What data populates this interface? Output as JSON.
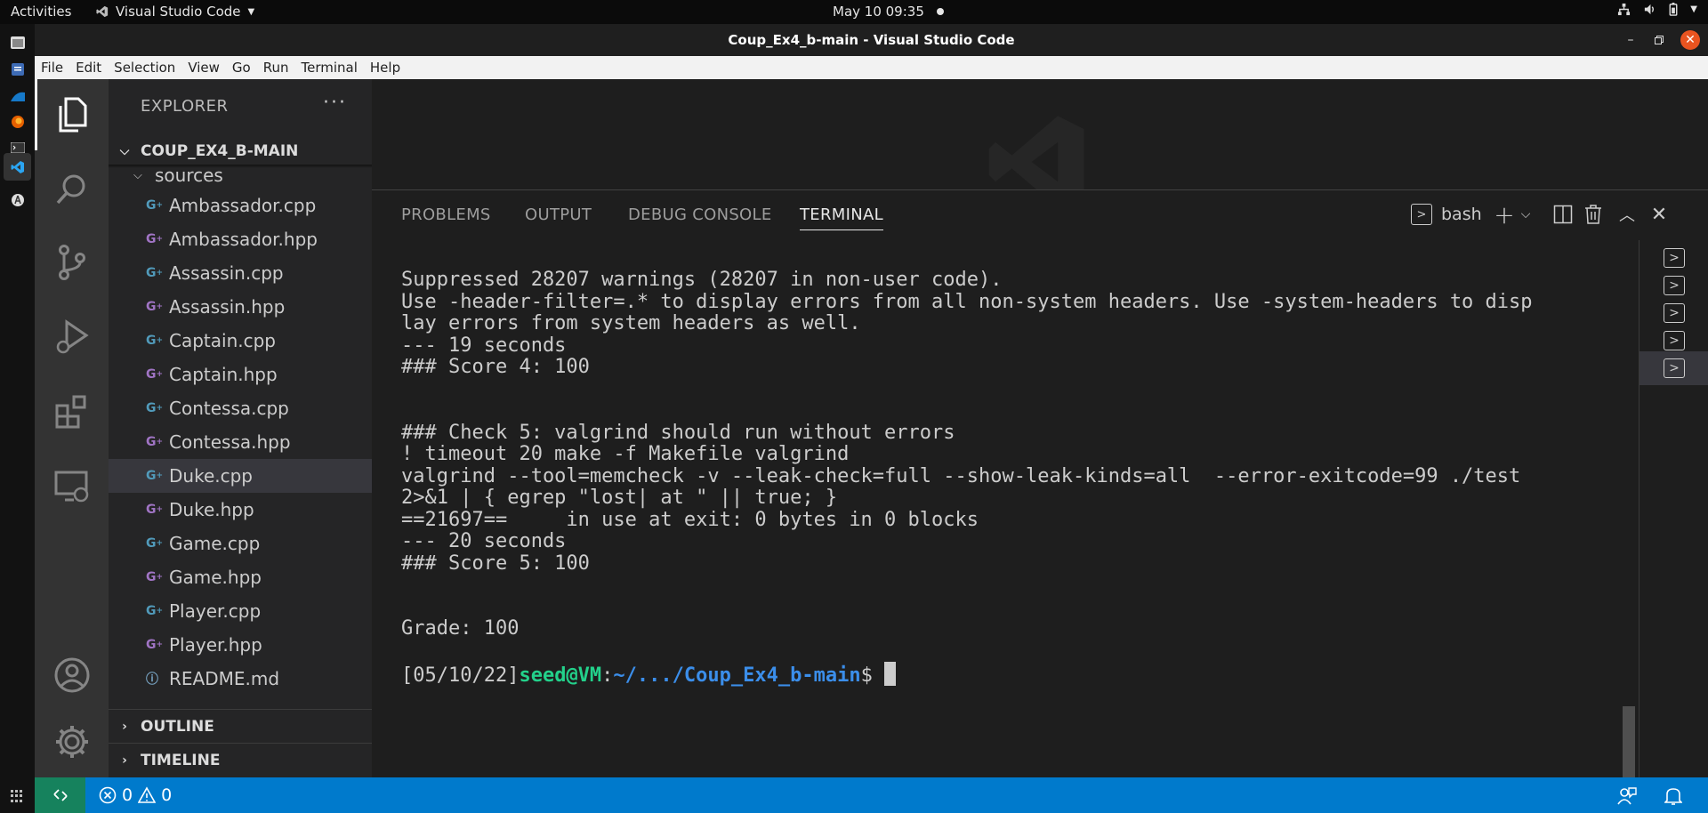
{
  "topbar": {
    "activities": "Activities",
    "app_name": "Visual Studio Code",
    "clock": "May 10  09:35"
  },
  "window": {
    "title": "Coup_Ex4_b-main - Visual Studio Code"
  },
  "menu": [
    "File",
    "Edit",
    "Selection",
    "View",
    "Go",
    "Run",
    "Terminal",
    "Help"
  ],
  "explorer": {
    "header": "EXPLORER",
    "more": "···",
    "root_folder": "COUP_EX4_B-MAIN",
    "subfolder": "sources",
    "files": [
      {
        "name": "Ambassador.cpp",
        "type": "cpp"
      },
      {
        "name": "Ambassador.hpp",
        "type": "hpp"
      },
      {
        "name": "Assassin.cpp",
        "type": "cpp"
      },
      {
        "name": "Assassin.hpp",
        "type": "hpp"
      },
      {
        "name": "Captain.cpp",
        "type": "cpp"
      },
      {
        "name": "Captain.hpp",
        "type": "hpp"
      },
      {
        "name": "Contessa.cpp",
        "type": "cpp"
      },
      {
        "name": "Contessa.hpp",
        "type": "hpp"
      },
      {
        "name": "Duke.cpp",
        "type": "cpp"
      },
      {
        "name": "Duke.hpp",
        "type": "hpp"
      },
      {
        "name": "Game.cpp",
        "type": "cpp"
      },
      {
        "name": "Game.hpp",
        "type": "hpp"
      },
      {
        "name": "Player.cpp",
        "type": "cpp"
      },
      {
        "name": "Player.hpp",
        "type": "hpp"
      },
      {
        "name": "README.md",
        "type": "info"
      }
    ],
    "selected_file": "Duke.cpp",
    "sections": {
      "outline": "OUTLINE",
      "timeline": "TIMELINE"
    }
  },
  "panel": {
    "tabs": [
      "PROBLEMS",
      "OUTPUT",
      "DEBUG CONSOLE",
      "TERMINAL"
    ],
    "active_tab": "TERMINAL",
    "shell_name": "bash",
    "terminal_lines": [
      "Suppressed 28207 warnings (28207 in non-user code).",
      "Use -header-filter=.* to display errors from all non-system headers. Use -system-headers to disp",
      "lay errors from system headers as well.",
      "--- 19 seconds",
      "### Score 4: 100",
      "",
      "",
      "### Check 5: valgrind should run without errors",
      "! timeout 20 make -f Makefile valgrind",
      "valgrind --tool=memcheck -v --leak-check=full --show-leak-kinds=all  --error-exitcode=99 ./test",
      "2>&1 | { egrep \"lost| at \" || true; }",
      "==21697==     in use at exit: 0 bytes in 0 blocks",
      "--- 20 seconds",
      "### Score 5: 100",
      "",
      "",
      "Grade: 100",
      ""
    ],
    "prompt": {
      "date": "[05/10/22]",
      "user": "seed@VM",
      "sep": ":",
      "path": "~/.../Coup_Ex4_b-main",
      "symbol": "$ "
    },
    "terminal_instance_count": 5
  },
  "statusbar": {
    "errors": "0",
    "warnings": "0"
  },
  "colors": {
    "statusbar": "#007acc",
    "remote": "#16825d",
    "prompt_user": "#23d18b",
    "prompt_path": "#3b8eea"
  }
}
